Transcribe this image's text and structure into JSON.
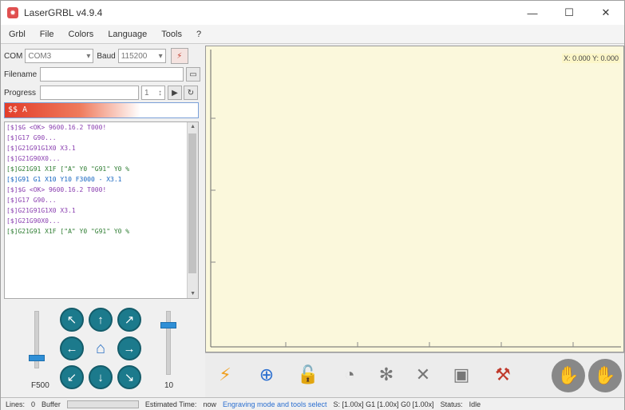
{
  "window": {
    "title": "LaserGRBL v4.9.4",
    "minimize": "—",
    "maximize": "☐",
    "close": "✕"
  },
  "menu": [
    "Grbl",
    "File",
    "Colors",
    "Language",
    "Tools",
    "?"
  ],
  "connection": {
    "com_label": "COM",
    "com_value": "COM3",
    "baud_label": "Baud",
    "baud_value": "115200"
  },
  "file": {
    "filename_label": "Filename",
    "progress_label": "Progress",
    "passes_value": "1"
  },
  "command_input": {
    "value": "$$ A"
  },
  "log": [
    {
      "text": "[$]$G <OK> 9600.16.2 T000!",
      "color": "#8a3fb0"
    },
    {
      "text": "[$]G17 G90...",
      "color": "#8a3fb0"
    },
    {
      "text": "[$]G21G91G1X0 X3.1",
      "color": "#8a3fb0"
    },
    {
      "text": "[$]G21G90X0...",
      "color": "#8a3fb0"
    },
    {
      "text": "[$]G21G91 X1F [\"A\" Y0 \"G91\" Y0 %",
      "color": "#2e7d32"
    },
    {
      "text": "[$]G91 G1 X10 Y10 F3000 - X3.1",
      "color": "#1565c0"
    },
    {
      "text": "[$]$G <OK> 9600.16.2 T000!",
      "color": "#8a3fb0"
    },
    {
      "text": "[$]G17 G90...",
      "color": "#8a3fb0"
    },
    {
      "text": "[$]G21G91G1X0 X3.1",
      "color": "#8a3fb0"
    },
    {
      "text": "[$]G21G90X0...",
      "color": "#8a3fb0"
    },
    {
      "text": "[$]G21G91 X1F [\"A\" Y0 \"G91\" Y0 %",
      "color": "#2e7d32"
    }
  ],
  "jog": {
    "speed_label": "F500",
    "step_label": "10",
    "speed_level": 0.18,
    "step_level": 0.78
  },
  "canvas": {
    "coordinates": "X: 0.000 Y: 0.000"
  },
  "toolbar": {
    "tools": [
      "flash-icon",
      "center-icon",
      "unlock-icon",
      "pause-icon",
      "settings-icon",
      "focus-icon",
      "frame-icon",
      "hammer-icon",
      "walk-icon",
      "stop-icon"
    ]
  },
  "status": {
    "lines_label": "Lines:",
    "lines_value": "0",
    "buffer_label": "Buffer",
    "estimated_label": "Estimated Time:",
    "estimated_value": "now",
    "mode": "Engraving mode and tools select",
    "speeds": "S: [1.00x] G1 [1.00x] G0 [1.00x]",
    "status_label": "Status:",
    "status_value": "Idle"
  },
  "colors": {
    "jog_button": "#1c7a8c",
    "slider_accent": "#2f8fd6",
    "canvas_bg": "#fbf8dc",
    "command_highlight": "#e23d2a"
  }
}
